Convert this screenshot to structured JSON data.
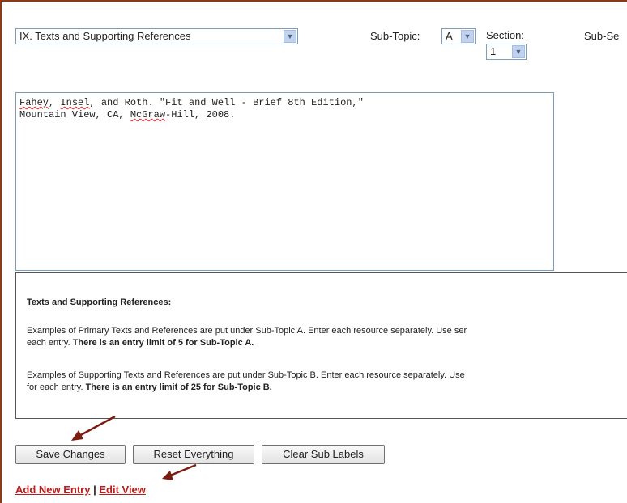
{
  "topic_select": {
    "value": "IX. Texts and Supporting References"
  },
  "subtopic": {
    "label": "Sub-Topic:",
    "value": "A"
  },
  "section": {
    "label": "Section:",
    "value": "1"
  },
  "subsection": {
    "label": "Sub-Se"
  },
  "editor": {
    "line1": ". \"Fit and Well - Brief 8th Edition,\"",
    "line1_names": {
      "a": "Fahey",
      "b": "Insel",
      "c": ", and Roth"
    },
    "line2_pre": "Mountain View, CA, ",
    "line2_pub": "McGraw",
    "line2_post": "-Hill, 2008."
  },
  "info": {
    "heading": "Texts and Supporting References:",
    "p1_a": "Examples of Primary Texts and References are put under Sub-Topic A. Enter each resource separately. Use ser",
    "p1_b": "each entry. ",
    "p1_bold": "There is an entry limit of 5 for Sub-Topic A.",
    "p2_a": "Examples of Supporting Texts and References are put under Sub-Topic B. Enter each resource separately. Use",
    "p2_b": "for each entry. ",
    "p2_bold": "There is an entry limit of 25 for Sub-Topic B."
  },
  "buttons": {
    "save": "Save Changes",
    "reset": "Reset Everything",
    "clear": "Clear Sub Labels"
  },
  "links": {
    "add": "Add New Entry",
    "separator": " | ",
    "edit": "Edit View"
  },
  "colors": {
    "frame": "#8a3a1a",
    "link": "#b81d1d",
    "annotation_arrow": "#7a1c10"
  }
}
